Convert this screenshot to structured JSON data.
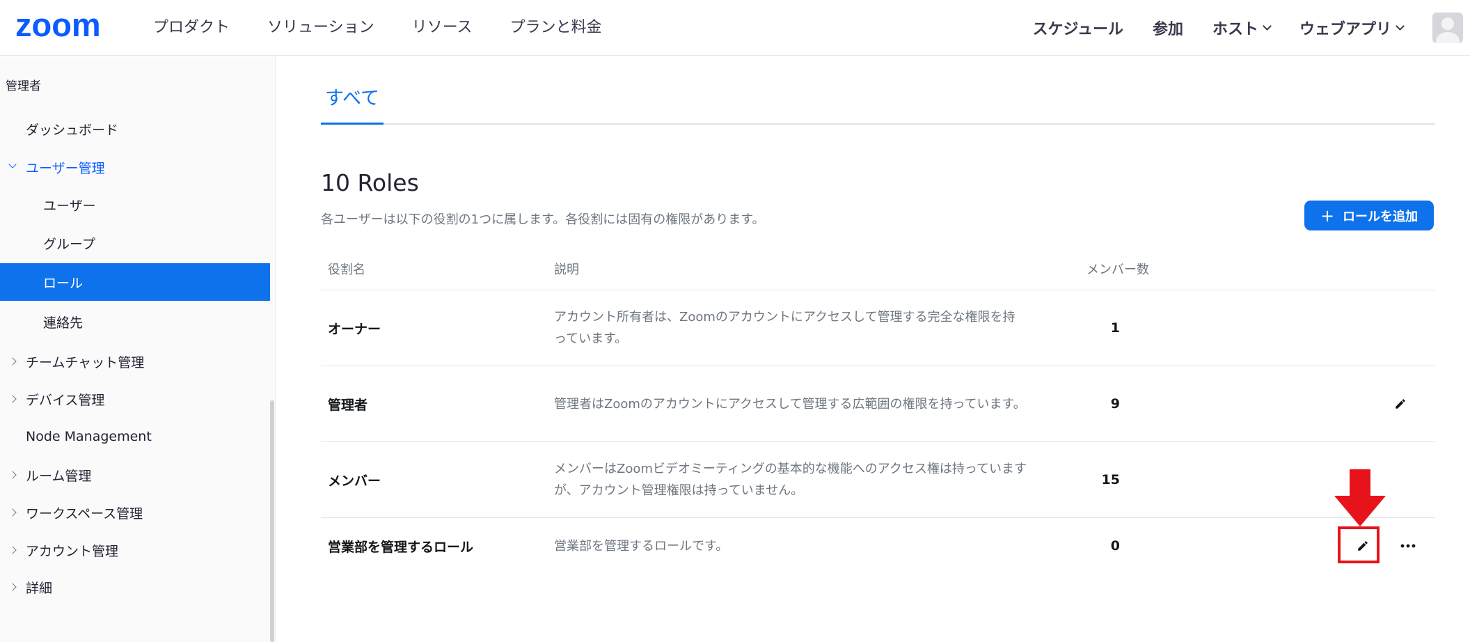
{
  "header": {
    "logo": "zoom",
    "nav_left": [
      "プロダクト",
      "ソリューション",
      "リソース",
      "プランと料金"
    ],
    "nav_right": [
      {
        "label": "スケジュール",
        "dropdown": false
      },
      {
        "label": "参加",
        "dropdown": false
      },
      {
        "label": "ホスト",
        "dropdown": true
      },
      {
        "label": "ウェブアプリ",
        "dropdown": true
      }
    ]
  },
  "sidebar": {
    "section_label": "管理者",
    "items": [
      {
        "label": "ダッシュボード"
      },
      {
        "label": "ユーザー管理",
        "expanded": true
      },
      {
        "label": "ユーザー"
      },
      {
        "label": "グループ"
      },
      {
        "label": "ロール",
        "active": true
      },
      {
        "label": "連絡先"
      },
      {
        "label": "チームチャット管理"
      },
      {
        "label": "デバイス管理"
      },
      {
        "label": "Node Management"
      },
      {
        "label": "ルーム管理"
      },
      {
        "label": "ワークスペース管理"
      },
      {
        "label": "アカウント管理"
      },
      {
        "label": "詳細"
      }
    ]
  },
  "main": {
    "tab": "すべて",
    "title": "10 Roles",
    "subtitle": "各ユーザーは以下の役割の1つに属します。各役割には固有の権限があります。",
    "add_button": "ロールを追加",
    "columns": {
      "name": "役割名",
      "description": "説明",
      "members": "メンバー数"
    },
    "rows": [
      {
        "name": "オーナー",
        "description": "アカウント所有者は、Zoomのアカウントにアクセスして管理する完全な権限を持っています。",
        "members": "1"
      },
      {
        "name": "管理者",
        "description": "管理者はZoomのアカウントにアクセスして管理する広範囲の権限を持っています。",
        "members": "9"
      },
      {
        "name": "メンバー",
        "description": "メンバーはZoomビデオミーティングの基本的な機能へのアクセス権は持っていますが、アカウント管理権限は持っていません。",
        "members": "15"
      },
      {
        "name": "営業部を管理するロール",
        "description": "営業部を管理するロールです。",
        "members": "0"
      }
    ]
  },
  "colors": {
    "brand": "#0b5cff",
    "accent": "#0e72ed",
    "annotation": "#e8131a"
  }
}
